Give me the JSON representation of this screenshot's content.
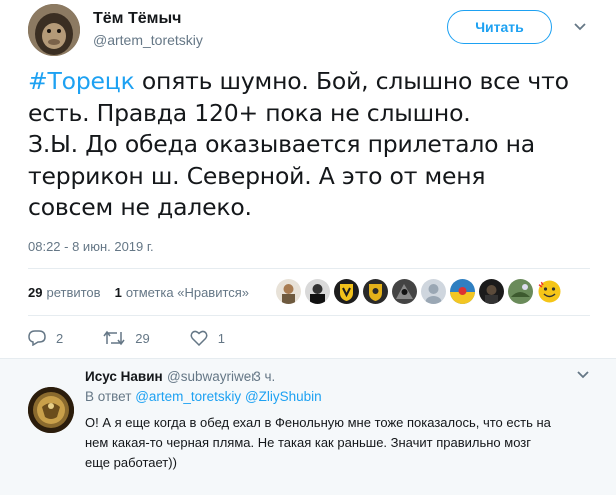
{
  "tweet": {
    "author_name": "Тём Тёмыч",
    "author_handle": "@artem_toretskiy",
    "follow_label": "Читать",
    "hashtag": "#Торецк",
    "line1_rest": " опять шумно. Бой, слышно все что",
    "line2": "есть. Правда 120+ пока не слышно.",
    "line3": "З.Ы. До обеда оказывается прилетало на",
    "line4": "террикон ш. Северной. А это от меня",
    "line5": "совсем не далеко.",
    "timestamp": "08:22 - 8 июн. 2019 г."
  },
  "stats": {
    "retweets_count": "29",
    "retweets_label": "ретвитов",
    "likes_count": "1",
    "likes_label": "отметка «Нравится»"
  },
  "actions": {
    "reply_count": "2",
    "retweet_count": "29",
    "like_count": "1"
  },
  "reply": {
    "author_name": "Исус Навин",
    "author_handle": "@subwayriwer",
    "time_ago": "· 3 ч.",
    "reply_prefix": "В ответ",
    "mention1": "@artem_toretskiy",
    "mention2": "@ZliyShubin",
    "text_line1": "О! А я еще когда в обед ехал в Фенольную мне тоже показалось, что есть на",
    "text_line2": "нем какая-то черная пляма. Не такая как раньше. Значит правильно мозг",
    "text_line3": "еще работает))"
  },
  "colors": {
    "accent": "#1da1f2",
    "secondary_text": "#657786",
    "divider": "#e6ecf0",
    "reply_background": "#f5f8fa"
  }
}
